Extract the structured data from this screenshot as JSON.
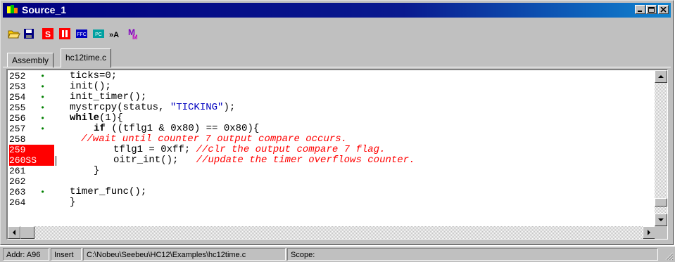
{
  "window": {
    "title": "Source_1"
  },
  "toolbar": {
    "buttons": [
      {
        "name": "open-folder-icon"
      },
      {
        "name": "save-icon"
      },
      {
        "name": "s-icon",
        "glyph": "S"
      },
      {
        "name": "break-icon",
        "glyph": "II"
      },
      {
        "name": "ffc-icon",
        "glyph": "FFC"
      },
      {
        "name": "pc-icon",
        "glyph": "PC"
      },
      {
        "name": "find-icon",
        "glyph": "»A"
      },
      {
        "name": "marker-icon",
        "glyph": "M"
      }
    ]
  },
  "tabs": [
    {
      "label": "Assembly"
    },
    {
      "label": "hc12time.c"
    }
  ],
  "lines": [
    {
      "num": "252",
      "dot": true
    },
    {
      "num": "253",
      "dot": true
    },
    {
      "num": "254",
      "dot": true
    },
    {
      "num": "255",
      "dot": true
    },
    {
      "num": "256",
      "dot": true
    },
    {
      "num": "257",
      "dot": true
    },
    {
      "num": "258",
      "dot": false
    },
    {
      "num": "259",
      "dot": false
    },
    {
      "num": "260SS",
      "dot": false
    },
    {
      "num": "261",
      "dot": false
    },
    {
      "num": "262",
      "dot": false
    },
    {
      "num": "263",
      "dot": true
    },
    {
      "num": "264",
      "dot": false
    }
  ],
  "code": {
    "l0": "ticks=0;",
    "l1": "init();",
    "l2": "init_timer();",
    "l3_a": "mystrcpy(status, ",
    "l3_b": "\"TICKING\"",
    "l3_c": ");",
    "l4_a": "while",
    "l4_b": "(1){",
    "l5_a": "if",
    "l5_b": " ((tflg1 & 0x80) == 0x80){",
    "l6": "//wait until counter 7 output compare occurs.",
    "l7_a": "tflg1 = 0xff; ",
    "l7_b": "//clr the output compare 7 flag.",
    "l8_a": "oitr_int();   ",
    "l8_b": "//update the timer overflows counter.",
    "l9": "}",
    "l10": "",
    "l11": "timer_func();",
    "l12": "}"
  },
  "status": {
    "addr": "Addr: A96",
    "mode": "Insert",
    "path": "C:\\Nobeu\\Seebeu\\HC12\\Examples\\hc12time.c",
    "scope": "Scope:"
  },
  "colors": {
    "titlebar": "#000080",
    "breakpoint": "#ff0000",
    "comment": "#ff0000",
    "string": "#0000c0",
    "dot": "#008000"
  }
}
